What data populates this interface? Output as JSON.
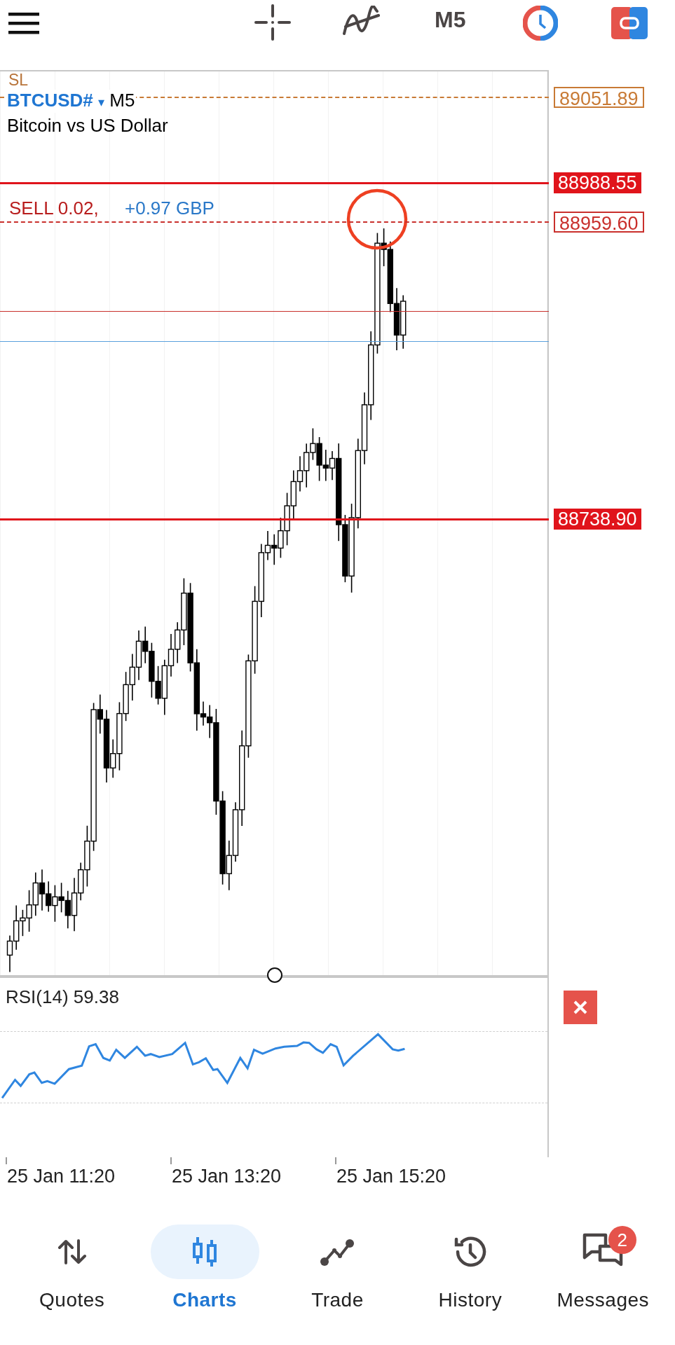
{
  "toolbar": {
    "timeframe": "M5"
  },
  "chart": {
    "sl_label": "SL",
    "symbol": "BTCUSD#",
    "symbol_caret": "▾",
    "timeframe": "M5",
    "description": "Bitcoin vs US Dollar",
    "position": {
      "side": "SELL 0.02,",
      "profit": "+0.97 GBP"
    },
    "price_lines": [
      {
        "kind": "stop_loss",
        "color": "#c87a35",
        "price": "89051.89"
      },
      {
        "kind": "alert",
        "color": "#e0141b",
        "price": "88988.55"
      },
      {
        "kind": "order",
        "color": "#c9302c",
        "price": "88959.60"
      },
      {
        "kind": "ask",
        "color": "#c9302c"
      },
      {
        "kind": "bid",
        "color": "#5aa0dc"
      },
      {
        "kind": "alert",
        "color": "#e0141b",
        "price": "88738.90"
      }
    ]
  },
  "indicator": {
    "label": "RSI(14) 59.38"
  },
  "time_axis": [
    "25 Jan 11:20",
    "25 Jan 13:20",
    "25 Jan 15:20"
  ],
  "nav": [
    {
      "label": "Quotes",
      "selected": false
    },
    {
      "label": "Charts",
      "selected": true
    },
    {
      "label": "Trade",
      "selected": false
    },
    {
      "label": "History",
      "selected": false
    },
    {
      "label": "Messages",
      "selected": false,
      "badge": "2"
    }
  ]
}
